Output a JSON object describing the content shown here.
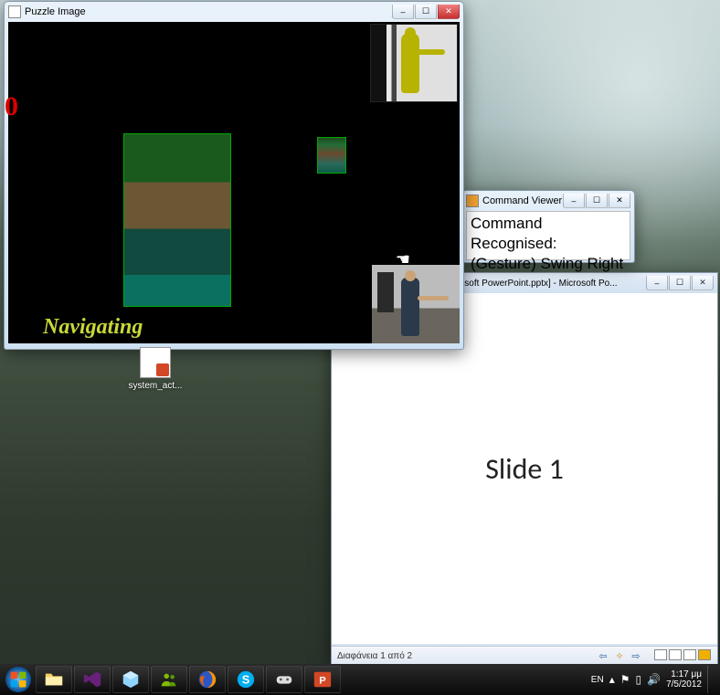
{
  "desktop": {
    "icon_label": "system_act..."
  },
  "puzzle_window": {
    "title": "Puzzle Image",
    "counter": "0",
    "status_label": "Navigating"
  },
  "command_viewer": {
    "title": "Command Viewer",
    "line1": "Command Recognised:",
    "line2": "(Gesture) Swing Right"
  },
  "powerpoint": {
    "title": "New Παρουσίαση του Microsoft PowerPoint.pptx] - Microsoft Po...",
    "slide_text": "Slide 1",
    "status_left": "Διαφάνεια 1 από 2"
  },
  "taskbar": {
    "lang": "EN",
    "time": "1:17 μμ",
    "date": "7/5/2012"
  },
  "window_controls": {
    "min": "–",
    "max": "☐",
    "close": "✕"
  }
}
